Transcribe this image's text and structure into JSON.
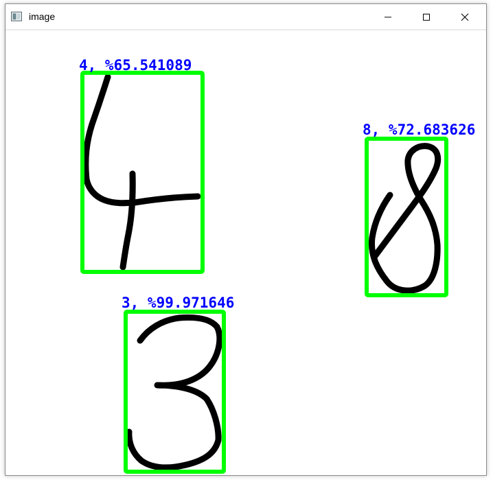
{
  "window": {
    "title": "image",
    "icon": "image-window-icon",
    "controls": [
      "minimize-icon",
      "maximize-icon",
      "close-icon"
    ]
  },
  "detections": [
    {
      "digit": "4",
      "label": "4, %65.541089",
      "confidence": 65.541089
    },
    {
      "digit": "8",
      "label": "8, %72.683626",
      "confidence": 72.683626
    },
    {
      "digit": "3",
      "label": "3, %99.971646",
      "confidence": 99.971646
    }
  ],
  "colors": {
    "box": "#00ff00",
    "label": "#0000ff",
    "stroke": "#000000"
  }
}
